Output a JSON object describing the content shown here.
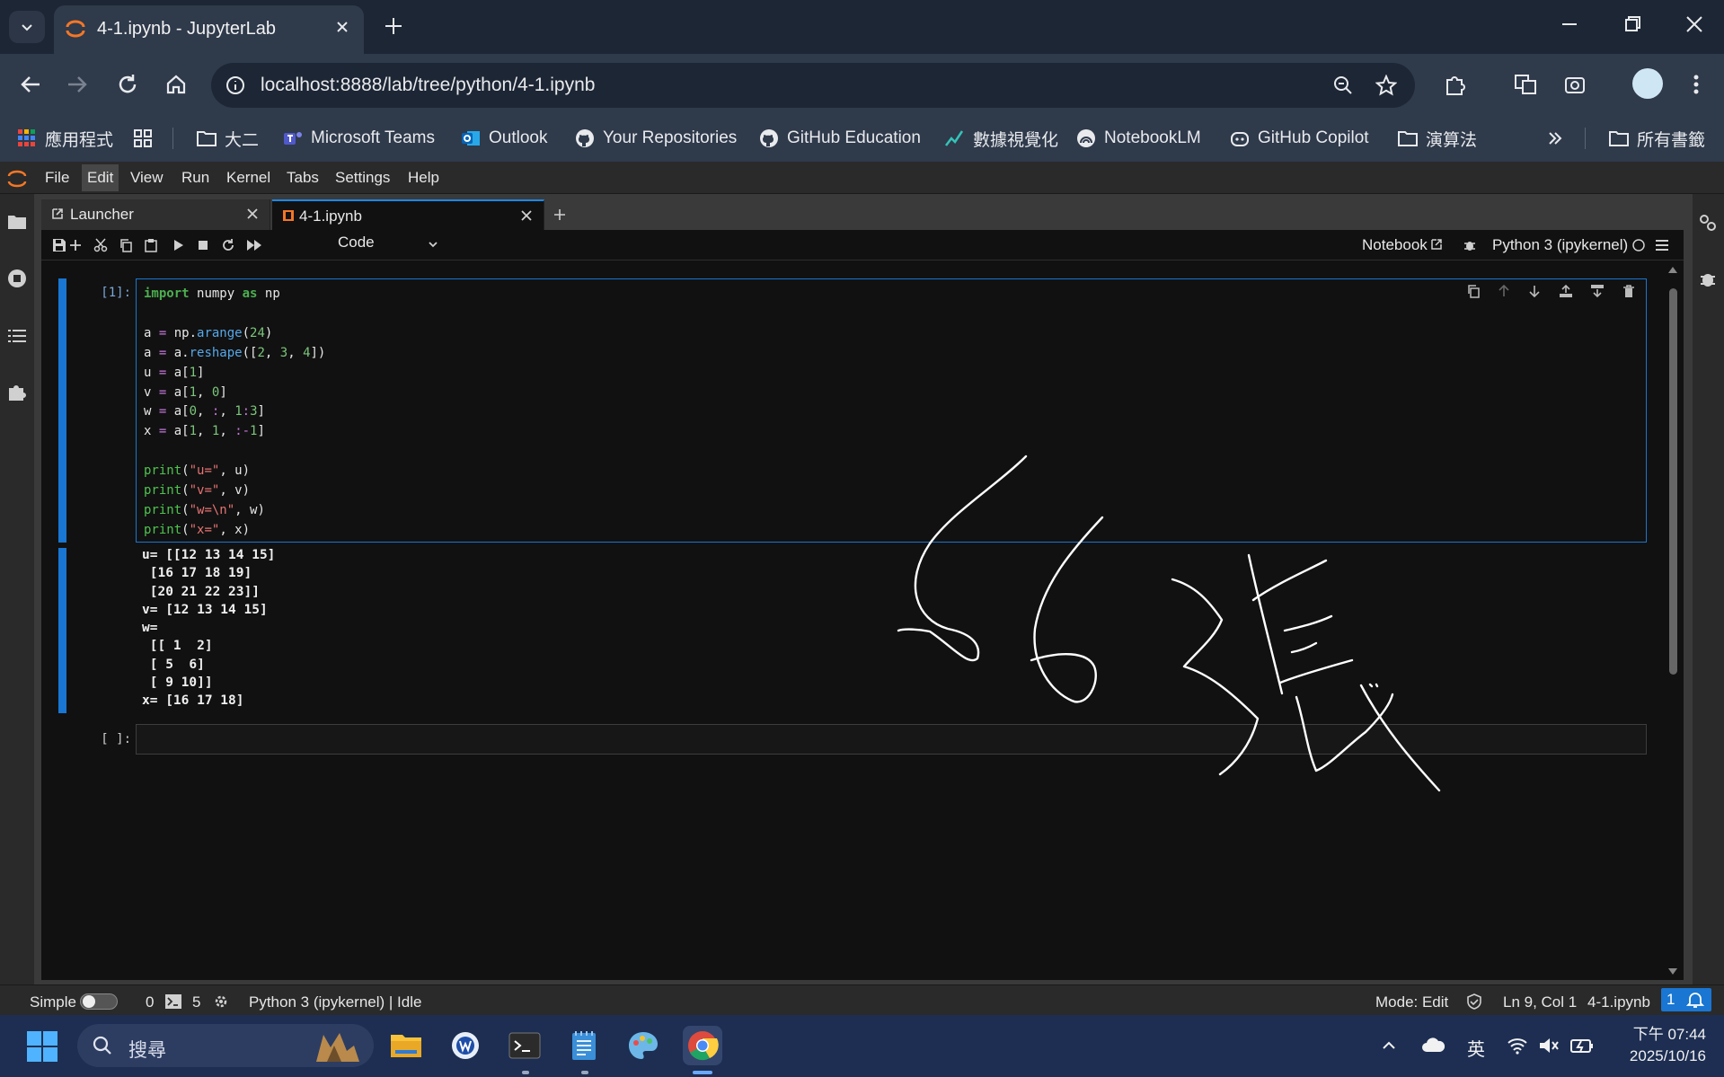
{
  "browser": {
    "tab_title": "4-1.ipynb - JupyterLab",
    "url": "localhost:8888/lab/tree/python/4-1.ipynb",
    "bookmarks": [
      {
        "label": "應用程式",
        "icon": "apps-grid-icon"
      },
      {
        "label": "大二",
        "icon": "folder-icon"
      },
      {
        "label": "Microsoft Teams",
        "icon": "teams-icon"
      },
      {
        "label": "Outlook",
        "icon": "outlook-icon"
      },
      {
        "label": "Your Repositories",
        "icon": "github-icon"
      },
      {
        "label": "GitHub Education",
        "icon": "github-icon"
      },
      {
        "label": "數據視覺化",
        "icon": "chart-line-icon"
      },
      {
        "label": "NotebookLM",
        "icon": "notebooklm-icon"
      },
      {
        "label": "GitHub Copilot",
        "icon": "copilot-icon"
      },
      {
        "label": "演算法",
        "icon": "folder-icon"
      },
      {
        "label": "所有書籤",
        "icon": "folder-icon"
      }
    ]
  },
  "jupyter": {
    "menu": [
      "File",
      "Edit",
      "View",
      "Run",
      "Kernel",
      "Tabs",
      "Settings",
      "Help"
    ],
    "active_menu": "Edit",
    "tabs": [
      {
        "label": "Launcher",
        "icon": "launcher-icon"
      },
      {
        "label": "4-1.ipynb",
        "icon": "notebook-icon"
      }
    ],
    "toolbar": {
      "cell_type": "Code",
      "notebook_link": "Notebook",
      "kernel": "Python 3 (ipykernel)"
    },
    "cells": [
      {
        "prompt": "[1]:",
        "output_lines": [
          "u= [[12 13 14 15]",
          " [16 17 18 19]",
          " [20 21 22 23]]",
          "v= [12 13 14 15]",
          "w=",
          " [[ 1  2]",
          " [ 5  6]",
          " [ 9 10]]",
          "x= [16 17 18]"
        ]
      },
      {
        "prompt": "[ ]:"
      }
    ],
    "code_tokens": {
      "import": "import",
      "numpy": "numpy",
      "as": "as",
      "np": "np",
      "arange": "arange",
      "reshape": "reshape",
      "print": "print"
    }
  },
  "statusbar": {
    "mode_label": "Simple",
    "terminals": "0",
    "kernels": "5",
    "kernel_status": "Python 3 (ipykernel) | Idle",
    "mode": "Mode: Edit",
    "cursor": "Ln 9, Col 1",
    "file": "4-1.ipynb",
    "notifications": "1"
  },
  "taskbar": {
    "search_placeholder": "搜尋",
    "ime": "英",
    "time": "下午 07:44",
    "date": "2025/10/16"
  },
  "colors": {
    "jupyter_accent": "#1976d2",
    "jupyter_logo": "#f37726",
    "chrome_frame": "#1d2634",
    "taskbar": "#1d2e52"
  }
}
